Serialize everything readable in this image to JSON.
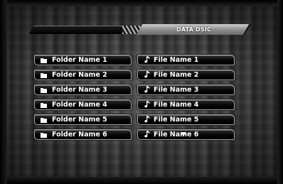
{
  "header": {
    "title": "DATA DSIC"
  },
  "folders": [
    {
      "label": "Folder Name 1",
      "icon": "folder-icon"
    },
    {
      "label": "Folder Name 2",
      "icon": "folder-icon"
    },
    {
      "label": "Folder Name 3",
      "icon": "folder-icon"
    },
    {
      "label": "Folder Name 4",
      "icon": "folder-icon"
    },
    {
      "label": "Folder Name 5",
      "icon": "folder-icon"
    },
    {
      "label": "Folder Name 6",
      "icon": "folder-icon"
    }
  ],
  "files": [
    {
      "label": "File Name 1",
      "icon": "music-note-icon"
    },
    {
      "label": "File Name 2",
      "icon": "music-note-icon"
    },
    {
      "label": "File Name 3",
      "icon": "music-note-icon"
    },
    {
      "label": "File Name 4",
      "icon": "music-note-icon"
    },
    {
      "label": "File Name 5",
      "icon": "music-note-icon"
    },
    {
      "label": "File Name 6",
      "icon": "music-note-icon"
    }
  ],
  "scroll": {
    "icon": "scroll-down-arrow-icon"
  },
  "colors": {
    "text": "#ffffff",
    "button_border": "#a9a9a9",
    "button_fill": "#000000"
  }
}
